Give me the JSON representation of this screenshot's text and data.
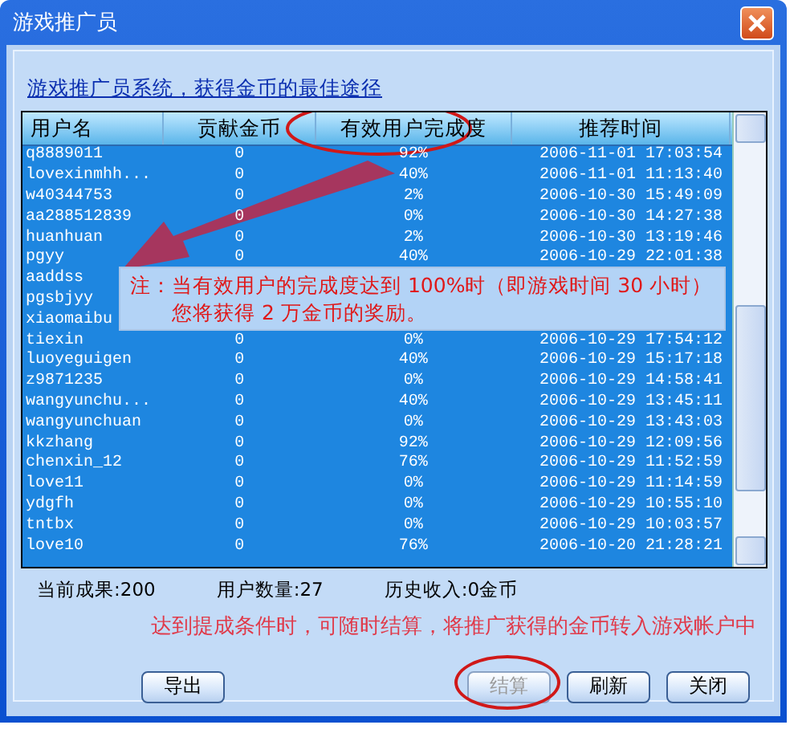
{
  "window": {
    "title": "游戏推广员"
  },
  "link": "游戏推广员系统，获得金币的最佳途径",
  "table": {
    "columns": [
      "用户名",
      "贡献金币",
      "有效用户完成度",
      "推荐时间"
    ],
    "rows": [
      {
        "name": "q8889011",
        "coins": "0",
        "rate": "92%",
        "time": "2006-11-01 17:03:54"
      },
      {
        "name": "lovexinmhh...",
        "coins": "0",
        "rate": "40%",
        "time": "2006-11-01 11:13:40"
      },
      {
        "name": "w40344753",
        "coins": "0",
        "rate": "2%",
        "time": "2006-10-30 15:49:09"
      },
      {
        "name": "aa288512839",
        "coins": "0",
        "rate": "0%",
        "time": "2006-10-30 14:27:38"
      },
      {
        "name": "huanhuan",
        "coins": "0",
        "rate": "2%",
        "time": "2006-10-30 13:19:46"
      },
      {
        "name": "pgyy",
        "coins": "0",
        "rate": "40%",
        "time": "2006-10-29 22:01:38"
      },
      {
        "name": "aaddss"
      },
      {
        "name": "pgsbjyy"
      },
      {
        "name": "xiaomaibu"
      },
      {
        "name": "tiexin",
        "coins": "0",
        "rate": "0%",
        "time": "2006-10-29 17:54:12"
      },
      {
        "name": "luoyeguigen",
        "coins": "0",
        "rate": "40%",
        "time": "2006-10-29 15:17:18"
      },
      {
        "name": "z9871235",
        "coins": "0",
        "rate": "0%",
        "time": "2006-10-29 14:58:41"
      },
      {
        "name": "wangyunchu...",
        "coins": "0",
        "rate": "40%",
        "time": "2006-10-29 13:45:11"
      },
      {
        "name": "wangyunchuan",
        "coins": "0",
        "rate": "0%",
        "time": "2006-10-29 13:43:03"
      },
      {
        "name": "kkzhang",
        "coins": "0",
        "rate": "92%",
        "time": "2006-10-29 12:09:56"
      },
      {
        "name": "chenxin_12",
        "coins": "0",
        "rate": "76%",
        "time": "2006-10-29 11:52:59"
      },
      {
        "name": "love11",
        "coins": "0",
        "rate": "0%",
        "time": "2006-10-29 11:14:59"
      },
      {
        "name": "ydgfh",
        "coins": "0",
        "rate": "0%",
        "time": "2006-10-29 10:55:10"
      },
      {
        "name": "tntbx",
        "coins": "0",
        "rate": "0%",
        "time": "2006-10-29 10:03:57"
      },
      {
        "name": "love10",
        "coins": "0",
        "rate": "76%",
        "time": "2006-10-20 21:28:21"
      }
    ]
  },
  "note": [
    "注：当有效用户的完成度达到 100%时（即游戏时间 30 小时）",
    "您将获得 2 万金币的奖励。"
  ],
  "stats": [
    "当前成果:200",
    "用户数量:27",
    "历史收入:0金币"
  ],
  "hint": "达到提成条件时，可随时结算，将推广获得的金币转入游戏帐户中",
  "buttons": [
    {
      "label": "导出",
      "disabled": false
    },
    {
      "label": "结算",
      "disabled": true
    },
    {
      "label": "刷新",
      "disabled": false
    },
    {
      "label": "关闭",
      "disabled": false
    }
  ]
}
